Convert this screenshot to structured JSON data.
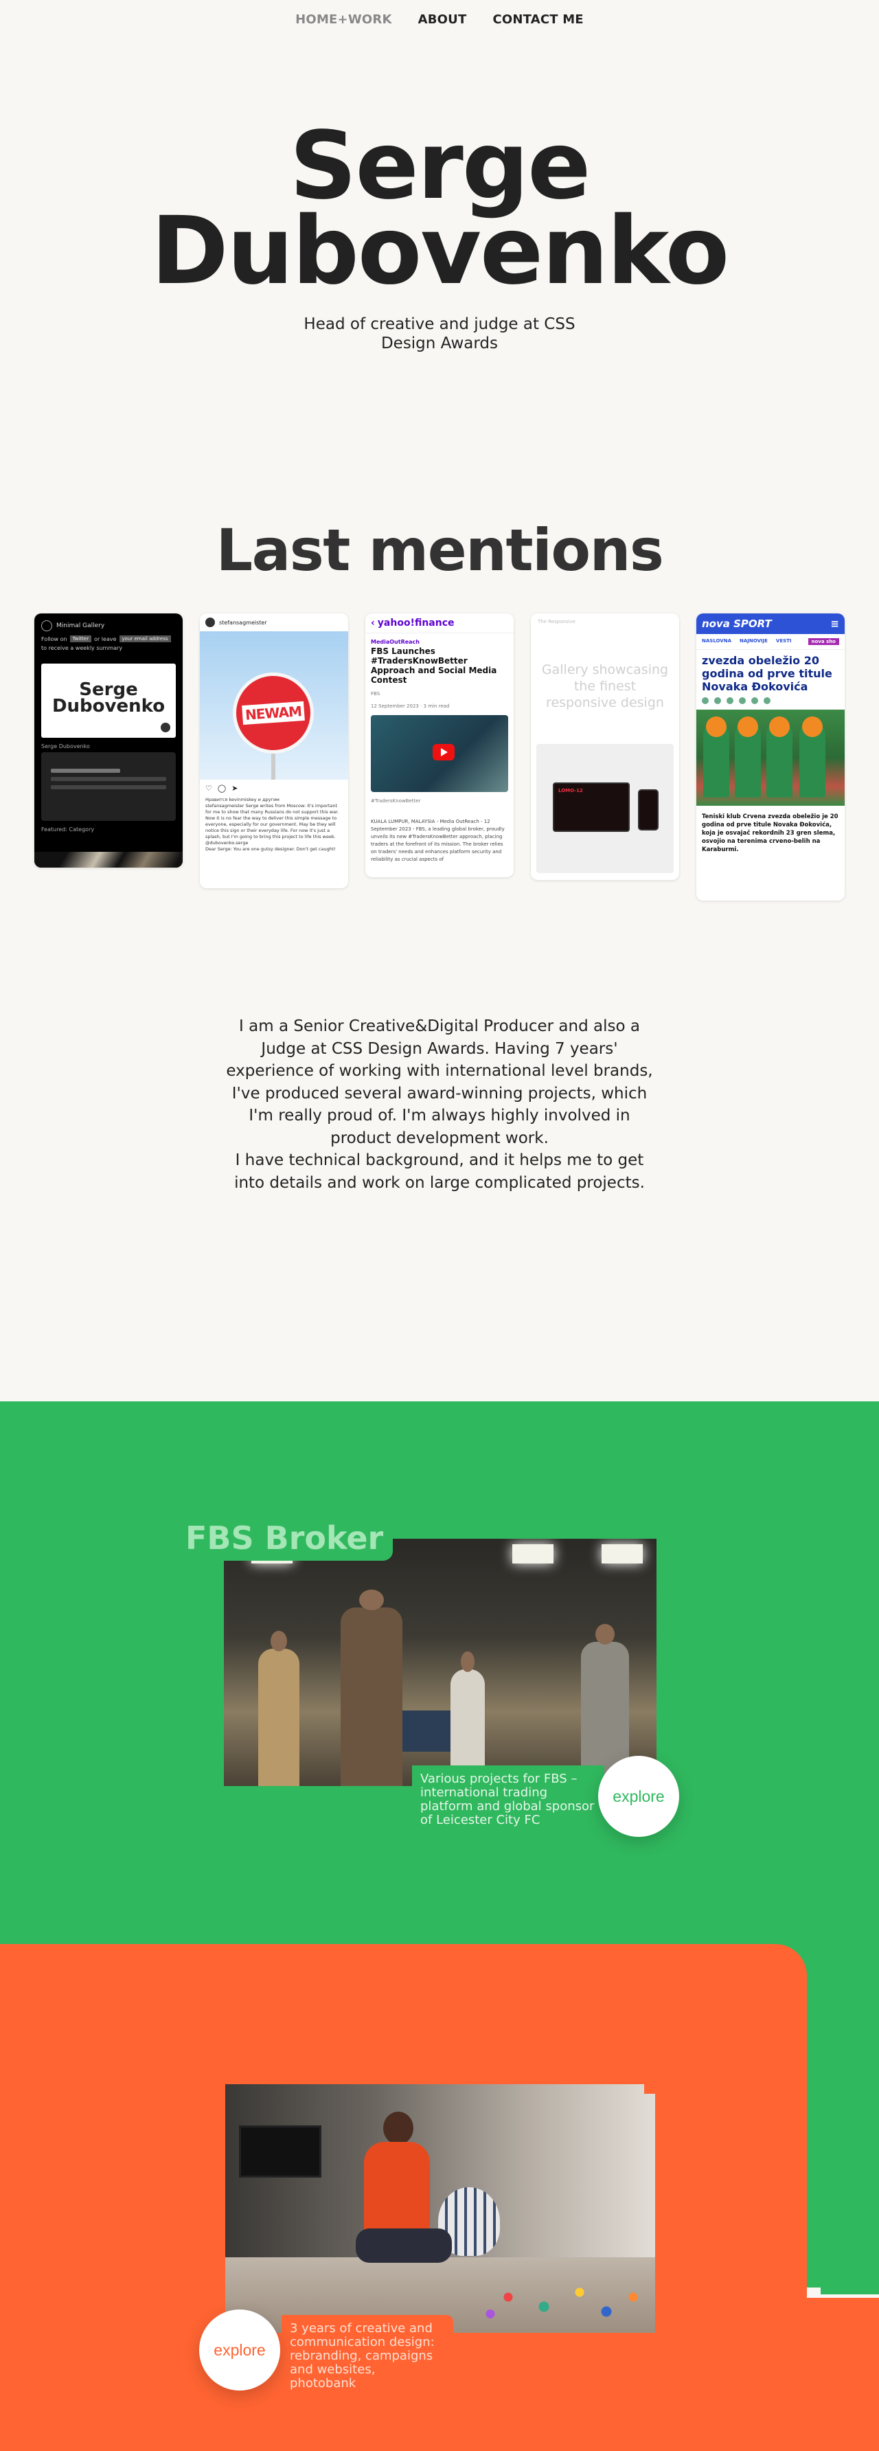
{
  "nav": {
    "items": [
      "HOME+WORK",
      "ABOUT",
      "CONTACT ME"
    ]
  },
  "hero": {
    "first_name": "Serge",
    "last_name": "Dubovenko",
    "subtitle": "Head of creative and judge at CSS Design Awards"
  },
  "mentions": {
    "title": "Last mentions",
    "cards": {
      "minimal_gallery": {
        "site_name": "Minimal Gallery",
        "follow_text": "Follow on",
        "twitter": "Twitter",
        "or_leave": "or leave",
        "email_placeholder": "your email address",
        "weekly": "to receive a weekly summary",
        "preview_title_1": "Serge",
        "preview_title_2": "Dubovenko",
        "name_label": "Serge Dubovenko",
        "footer_label": "Featured: Category"
      },
      "instagram": {
        "handle": "stefansagmeister",
        "sign_text": "NEWAM",
        "likes": "Нравится kevinmiskey и другим",
        "caption": "stefansagmeister Serge writes from Moscow: It's important for me to show that many Russians do not support this war. Now it is no fear the way to deliver this simple message to everyone, especially for our government. May be they will notice this sign or their everyday life. For now it's just a splash, but I'm going to bring this project to life this week. @dubovenko.serge",
        "comment": "Dear Serge: You are one gutsy designer. Don't get caught!"
      },
      "yahoo": {
        "brand": "yahoo!finance",
        "source": "MediaOutReach",
        "headline": "FBS Launches #TradersKnowBetter Approach and Social Media Contest",
        "byline": "FBS",
        "date": "12 September 2023 · 3 min read",
        "hashtag": "#TradersKnowBetter",
        "paragraph": "KUALA LUMPUR, MALAYSIA - Media OutReach - 12 September 2023 - FBS, a leading global broker, proudly unveils its new #TradersKnowBetter approach, placing traders at the forefront of its mission. The broker relies on traders' needs and enhances platform security and reliability as crucial aspects of"
      },
      "gallery": {
        "top_label": "The Responsive",
        "ghost_text": "Gallery showcasing the finest responsive design",
        "screen_label": "LOMO-12"
      },
      "nova": {
        "brand": "nova SPORT",
        "nav_1": "NASLOVNA",
        "nav_2": "NAJNOVIJE",
        "nav_3": "VESTI",
        "tag": "nova sho",
        "headline": "zvezda obeležio 20 godina od prve titule Novaka Đokovića",
        "body": "Teniski klub Crvena zvezda obeležio je 20 godina od prve titule Novaka Đokovića, koja je osvajač rekordnih 23 gren slema, osvojio na terenima crveno-belih na Karaburmi."
      }
    }
  },
  "about": {
    "paragraph_1": "I am a Senior Creative&Digital Producer and also a Judge at CSS Design Awards. Having 7 years' experience of working with international level brands, I've produced several award-winning projects, which I'm really proud of. I'm always highly involved in product development work.",
    "paragraph_2": "I have technical background, and it helps me to get into details and work on large complicated projects."
  },
  "projects": {
    "fbs": {
      "label": "FBS Broker",
      "caption": "Various projects for FBS – international trading platform and global sponsor of Leicester City FC",
      "button": "explore"
    },
    "second": {
      "caption": "3 years of creative and communication design: rebranding, campaigns and websites, photobank",
      "button": "explore"
    }
  },
  "colors": {
    "green": "#30b85e",
    "orange": "#ff6432",
    "background": "#f8f7f4",
    "text": "#222222"
  }
}
